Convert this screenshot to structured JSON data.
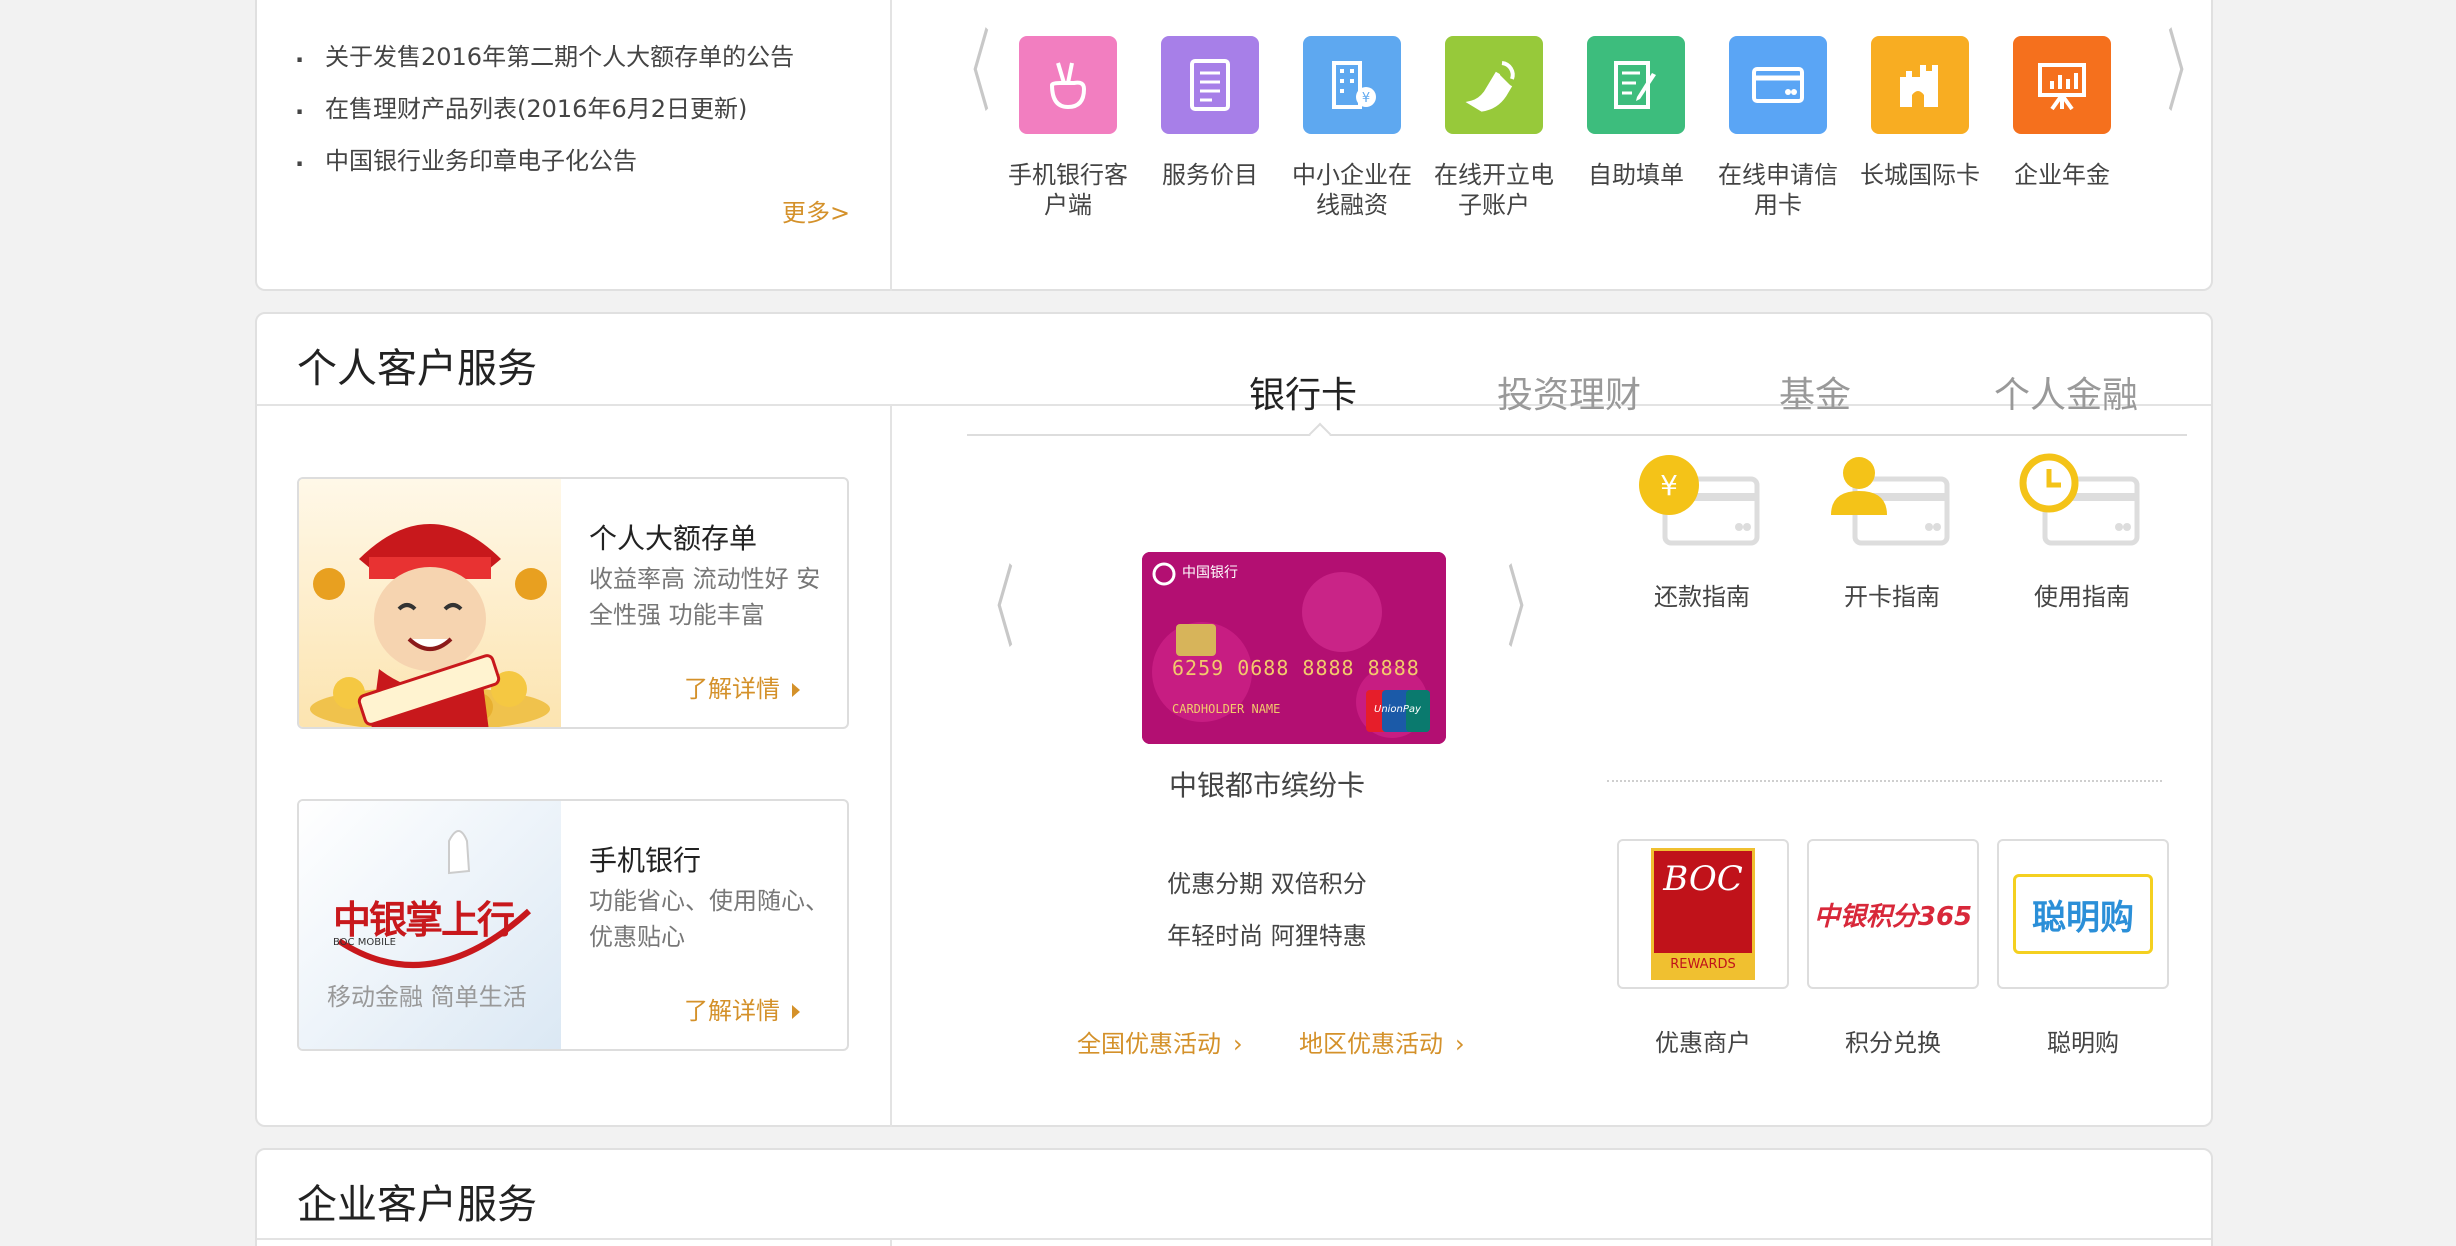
{
  "top": {
    "notices": [
      "关于发售2016年第二期个人大额存单的公告",
      "在售理财产品列表(2016年6月2日更新)",
      "中国银行业务印章电子化公告"
    ],
    "more_label": "更多>",
    "quick_nav": [
      {
        "label": "手机银行客户端",
        "icon": "thumbs-up-icon",
        "color": "#f27ec0"
      },
      {
        "label": "服务价目",
        "icon": "document-list-icon",
        "color": "#a77fe8"
      },
      {
        "label": "中小企业在线融资",
        "icon": "building-yen-icon",
        "color": "#5ea8f0"
      },
      {
        "label": "在线开立电子账户",
        "icon": "hand-pointer-icon",
        "color": "#97c93a"
      },
      {
        "label": "自助填单",
        "icon": "form-edit-icon",
        "color": "#3dbd7d"
      },
      {
        "label": "在线申请信用卡",
        "icon": "credit-card-icon",
        "color": "#5aa5f5"
      },
      {
        "label": "长城国际卡",
        "icon": "great-wall-icon",
        "color": "#f8ad22"
      },
      {
        "label": "企业年金",
        "icon": "presentation-chart-icon",
        "color": "#f5701d"
      }
    ]
  },
  "personal": {
    "title": "个人客户服务",
    "promos": [
      {
        "title": "个人大额存单",
        "desc": "收益率高 流动性好 安全性强 功能丰富",
        "link": "了解详情"
      },
      {
        "title": "手机银行",
        "desc": "功能省心、使用随心、优惠贴心",
        "link": "了解详情",
        "img_text": "中银掌上行",
        "img_sub": "BOC MOBILE",
        "img_slogan": "移动金融  简单生活"
      }
    ],
    "tabs": [
      "银行卡",
      "投资理财",
      "基金",
      "个人金融"
    ],
    "active_tab": "银行卡",
    "card": {
      "name": "中银都市缤纷卡",
      "features": [
        "优惠分期 双倍积分",
        "年轻时尚 阿狸特惠"
      ],
      "number": "6259 0688 8888 8888",
      "holder": "CARDHOLDER NAME",
      "bank": "中国银行",
      "unionpay": "UnionPay"
    },
    "activities": [
      "全国优惠活动",
      "地区优惠活动"
    ],
    "guides": [
      {
        "label": "还款指南",
        "icon": "yen-card-icon"
      },
      {
        "label": "开卡指南",
        "icon": "person-card-icon"
      },
      {
        "label": "使用指南",
        "icon": "clock-card-icon"
      }
    ],
    "services": [
      {
        "label": "优惠商户",
        "logo_text": "BOC",
        "logo_sub": "REWARDS"
      },
      {
        "label": "积分兑换",
        "logo_text": "中银积分365"
      },
      {
        "label": "聪明购",
        "logo_text": "聪明购"
      }
    ]
  },
  "corporate": {
    "title": "企业客户服务"
  },
  "colors": {
    "accent": "#d4912a",
    "guide_yellow": "#f4c318"
  }
}
